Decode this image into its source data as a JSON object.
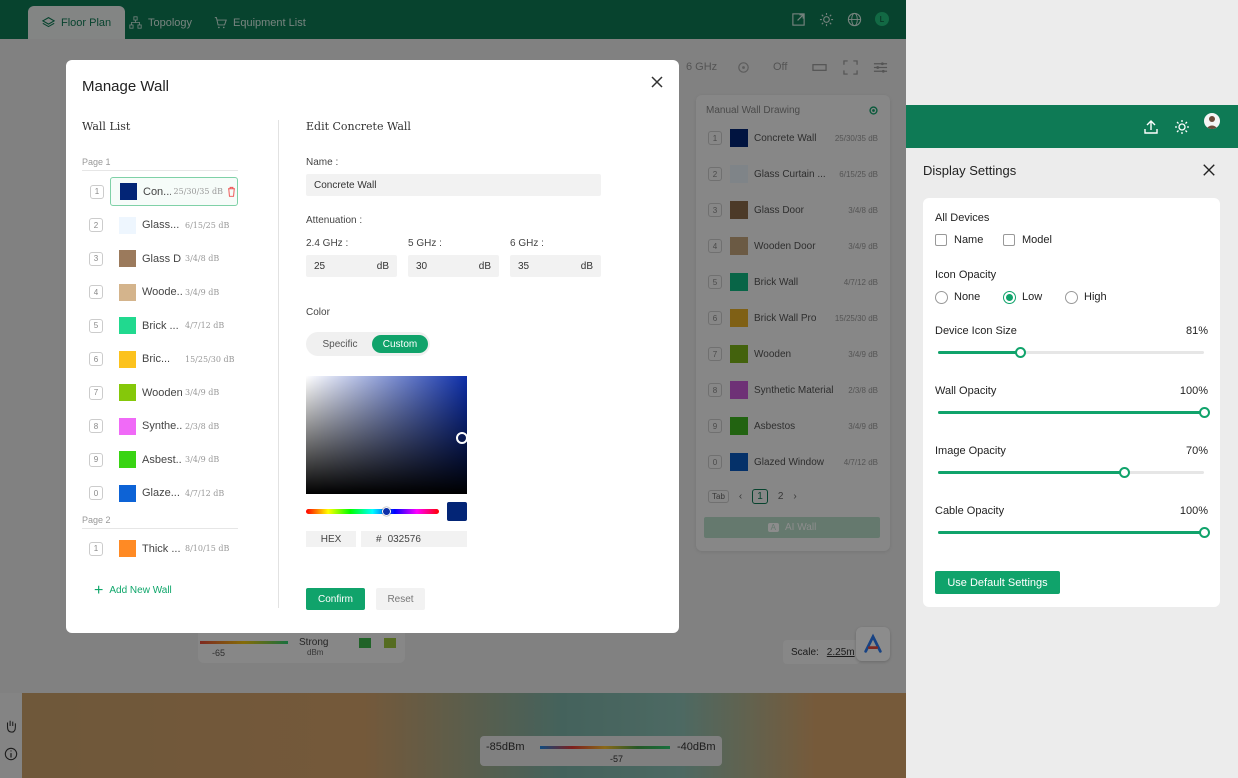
{
  "nav": {
    "tabs": [
      {
        "label": "Floor Plan"
      },
      {
        "label": "Topology"
      },
      {
        "label": "Equipment List"
      }
    ],
    "user_initial": "L"
  },
  "toolbar": {
    "band": "6 GHz",
    "toggle_state": "Off"
  },
  "wall_panel": {
    "title": "Manual Wall Drawing",
    "rows": [
      {
        "num": "1",
        "name": "Concrete Wall",
        "db": "25/30/35 dB",
        "color": "#032576"
      },
      {
        "num": "2",
        "name": "Glass Curtain ...",
        "db": "6/15/25 dB",
        "color": "#e8f0f8"
      },
      {
        "num": "3",
        "name": "Glass Door",
        "db": "3/4/8 dB",
        "color": "#8b6b4a"
      },
      {
        "num": "4",
        "name": "Wooden Door",
        "db": "3/4/9 dB",
        "color": "#c4a57d"
      },
      {
        "num": "5",
        "name": "Brick Wall",
        "db": "4/7/12 dB",
        "color": "#10b981"
      },
      {
        "num": "6",
        "name": "Brick Wall Pro",
        "db": "15/25/30 dB",
        "color": "#e7b027"
      },
      {
        "num": "7",
        "name": "Wooden",
        "db": "3/4/9 dB",
        "color": "#7bb319"
      },
      {
        "num": "8",
        "name": "Synthetic Material",
        "db": "2/3/8 dB",
        "color": "#c95ad8"
      },
      {
        "num": "9",
        "name": "Asbestos",
        "db": "3/4/9 dB",
        "color": "#3fb51f"
      },
      {
        "num": "0",
        "name": "Glazed Window",
        "db": "4/7/12 dB",
        "color": "#0a5ac0"
      }
    ],
    "pager_tab": "Tab",
    "pages": [
      "1",
      "2"
    ],
    "ai_badge": "A",
    "ai_label": "AI Wall"
  },
  "legend": {
    "min": "-65",
    "strong": "Strong",
    "unit": "dBm"
  },
  "scale": {
    "label": "Scale:",
    "value": "2.25m"
  },
  "signal_legend": {
    "low": "-85dBm",
    "high": "-40dBm",
    "mid": "-57"
  },
  "modal": {
    "title": "Manage Wall",
    "wall_list_heading": "Wall List",
    "page1_label": "Page 1",
    "page2_label": "Page 2",
    "walls": [
      {
        "num": "1",
        "name": "Con...",
        "db": "25/30/35 dB",
        "color": "#032576"
      },
      {
        "num": "2",
        "name": "Glass...",
        "db": "6/15/25 dB",
        "color": "#eef6fe"
      },
      {
        "num": "3",
        "name": "Glass D...",
        "db": "3/4/8 dB",
        "color": "#9b7a5c"
      },
      {
        "num": "4",
        "name": "Woode...",
        "db": "3/4/9 dB",
        "color": "#d4b48c"
      },
      {
        "num": "5",
        "name": "Brick ...",
        "db": "4/7/12 dB",
        "color": "#21d98f"
      },
      {
        "num": "6",
        "name": "Bric...",
        "db": "15/25/30 dB",
        "color": "#fcc21d"
      },
      {
        "num": "7",
        "name": "Wooden",
        "db": "3/4/9 dB",
        "color": "#85c80a"
      },
      {
        "num": "8",
        "name": "Synthe...",
        "db": "2/3/8 dB",
        "color": "#f06af7"
      },
      {
        "num": "9",
        "name": "Asbest...",
        "db": "3/4/9 dB",
        "color": "#39d413"
      },
      {
        "num": "0",
        "name": "Glaze...",
        "db": "4/7/12 dB",
        "color": "#0d63d6"
      }
    ],
    "page2_walls": [
      {
        "num": "1",
        "name": "Thick ...",
        "db": "8/10/15 dB",
        "color": "#ff8a24"
      }
    ],
    "add_new_wall": "Add New Wall",
    "edit_heading": "Edit Concrete Wall",
    "name_label": "Name :",
    "name_value": "Concrete Wall",
    "attenuation_label": "Attenuation :",
    "bands": [
      {
        "label": "2.4 GHz :",
        "value": "25",
        "unit": "dB"
      },
      {
        "label": "5 GHz :",
        "value": "30",
        "unit": "dB"
      },
      {
        "label": "6 GHz :",
        "value": "35",
        "unit": "dB"
      }
    ],
    "color_label": "Color",
    "color_tabs": {
      "specific": "Specific",
      "custom": "Custom"
    },
    "hex_label": "HEX",
    "hex_prefix": "#",
    "hex_value": "032576",
    "selected_color": "#032576",
    "confirm": "Confirm",
    "reset": "Reset"
  },
  "display_settings": {
    "title": "Display Settings",
    "all_devices": "All Devices",
    "checkbox_name": "Name",
    "checkbox_model": "Model",
    "icon_opacity": "Icon Opacity",
    "opacity_options": [
      "None",
      "Low",
      "High"
    ],
    "opacity_selected": "Low",
    "sliders": [
      {
        "label": "Device Icon Size",
        "value_text": "81%",
        "value": 0.31
      },
      {
        "label": "Wall Opacity",
        "value_text": "100%",
        "value": 1.0
      },
      {
        "label": "Image Opacity",
        "value_text": "70%",
        "value": 0.7
      },
      {
        "label": "Cable Opacity",
        "value_text": "100%",
        "value": 1.0
      }
    ],
    "default_button": "Use Default Settings"
  },
  "colors": {
    "brand": "#0e7a55",
    "accent": "#10a36b"
  }
}
